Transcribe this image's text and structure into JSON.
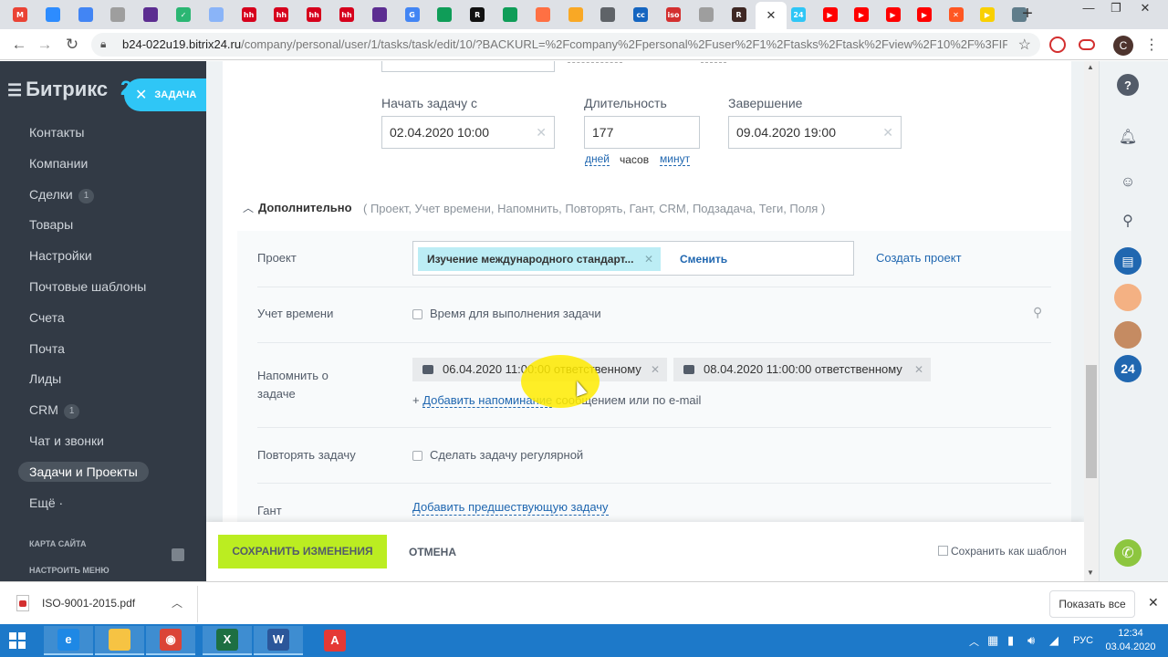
{
  "browser": {
    "tabs": [
      {
        "icon": "gmail-icon",
        "color": "#ea4335",
        "glyph": "M"
      },
      {
        "icon": "video-icon",
        "color": "#2d8cff",
        "glyph": ""
      },
      {
        "icon": "docs-icon",
        "color": "#4285f4",
        "glyph": ""
      },
      {
        "icon": "chart-icon",
        "color": "#9e9e9e",
        "glyph": ""
      },
      {
        "icon": "form-icon",
        "color": "#5c2d91",
        "glyph": ""
      },
      {
        "icon": "check-icon",
        "color": "#2bb673",
        "glyph": "✓"
      },
      {
        "icon": "cube-icon",
        "color": "#8ab4f8",
        "glyph": ""
      },
      {
        "icon": "hh-icon",
        "color": "#d6001c",
        "glyph": "hh"
      },
      {
        "icon": "hh-icon",
        "color": "#d6001c",
        "glyph": "hh"
      },
      {
        "icon": "hh-icon",
        "color": "#d6001c",
        "glyph": "hh"
      },
      {
        "icon": "hh-icon",
        "color": "#d6001c",
        "glyph": "hh"
      },
      {
        "icon": "form-icon",
        "color": "#5c2d91",
        "glyph": ""
      },
      {
        "icon": "google-icon",
        "color": "#4285f4",
        "glyph": "G"
      },
      {
        "icon": "sheets-icon",
        "color": "#0f9d58",
        "glyph": ""
      },
      {
        "icon": "r-icon",
        "color": "#111111",
        "glyph": "R"
      },
      {
        "icon": "home-icon",
        "color": "#0f9d58",
        "glyph": ""
      },
      {
        "icon": "refresh-icon",
        "color": "#ff7043",
        "glyph": ""
      },
      {
        "icon": "search-icon",
        "color": "#f9a825",
        "glyph": ""
      },
      {
        "icon": "globe-icon",
        "color": "#5f6368",
        "glyph": ""
      },
      {
        "icon": "cc-icon",
        "color": "#1565c0",
        "glyph": "cc"
      },
      {
        "icon": "iso-icon",
        "color": "#d32f2f",
        "glyph": "iso"
      },
      {
        "icon": "clock-icon",
        "color": "#9e9e9e",
        "glyph": ""
      },
      {
        "icon": "r-icon",
        "color": "#3e2723",
        "glyph": "R"
      }
    ],
    "tabs_after": [
      {
        "icon": "b24-icon",
        "color": "#2fc6f6",
        "glyph": "24"
      },
      {
        "icon": "youtube-icon",
        "color": "#ff0000",
        "glyph": "▶"
      },
      {
        "icon": "youtube-icon",
        "color": "#ff0000",
        "glyph": "▶"
      },
      {
        "icon": "youtube-icon",
        "color": "#ff0000",
        "glyph": "▶"
      },
      {
        "icon": "youtube-icon",
        "color": "#ff0000",
        "glyph": "▶"
      },
      {
        "icon": "x-icon",
        "color": "#ff5722",
        "glyph": "✕"
      },
      {
        "icon": "play-icon",
        "color": "#f9d000",
        "glyph": "▶"
      },
      {
        "icon": "bird-icon",
        "color": "#607d8b",
        "glyph": ""
      }
    ],
    "url_host": "b24-022u19.bitrix24.ru",
    "url_path": "/company/personal/user/1/tasks/task/edit/10/?BACKURL=%2Fcompany%2Fpersonal%2Fuser%2F1%2Ftasks%2Ftask%2Fview%2F10%2F%3FIFR...",
    "profile_letter": "C"
  },
  "sidebar": {
    "logo": "Битрикс",
    "logo_num": "24",
    "task_button": "ЗАДАЧА",
    "items": [
      {
        "label": "Контакты",
        "count": ""
      },
      {
        "label": "Компании",
        "count": ""
      },
      {
        "label": "Сделки",
        "count": "1"
      },
      {
        "label": "Товары",
        "count": ""
      },
      {
        "label": "Настройки",
        "count": ""
      },
      {
        "label": "Почтовые шаблоны",
        "count": ""
      },
      {
        "label": "Счета",
        "count": ""
      },
      {
        "label": "Почта",
        "count": ""
      },
      {
        "label": "Лиды",
        "count": ""
      },
      {
        "label": "CRM",
        "count": "1"
      },
      {
        "label": "Чат и звонки",
        "count": ""
      },
      {
        "label": "Задачи и Проекты",
        "count": ""
      },
      {
        "label": "Ещё ·",
        "count": ""
      }
    ],
    "sitemap": "КАРТА САЙТА",
    "configure": "НАСТРОИТЬ МЕНЮ"
  },
  "form": {
    "start_label": "Начать задачу с",
    "start_value": "02.04.2020 10:00",
    "duration_label": "Длительность",
    "duration_value": "177",
    "unit_days": "дней",
    "unit_hours": "часов",
    "unit_minutes": "минут",
    "end_label": "Завершение",
    "end_value": "09.04.2020 19:00",
    "additional_title": "Дополнительно",
    "additional_options": "( Проект,  Учет времени,  Напомнить,  Повторять,  Гант,  CRM,  Подзадача,  Теги,  Поля )",
    "project_label": "Проект",
    "project_tag": "Изучение международного стандарт...",
    "project_change": "Сменить",
    "project_create": "Создать проект",
    "time_label": "Учет времени",
    "time_checkbox": "Время для выполнения задачи",
    "remind_label": "Напомнить о задаче",
    "remind_1": "06.04.2020 11:00:00 ответственному",
    "remind_2": "08.04.2020 11:00:00 ответственному",
    "remind_add_prefix": "+ ",
    "remind_add_link": "Добавить напоминание",
    "remind_add_suffix": " сообщением или по e-mail",
    "repeat_label": "Повторять задачу",
    "repeat_checkbox": "Сделать задачу регулярной",
    "gantt_label": "Гант",
    "gantt_link": "Добавить предшествующую задачу"
  },
  "actions": {
    "save": "СОХРАНИТЬ ИЗМЕНЕНИЯ",
    "cancel": "ОТМЕНА",
    "template": "Сохранить как шаблон"
  },
  "right_panel": {
    "b24_badge": "24"
  },
  "download": {
    "file": "ISO-9001-2015.pdf",
    "show_all": "Показать все"
  },
  "taskbar": {
    "lang": "РУС",
    "time": "12:34",
    "date": "03.04.2020",
    "apps": [
      {
        "icon": "ie-icon",
        "color": "#1e88e5",
        "glyph": "e"
      },
      {
        "icon": "explorer-icon",
        "color": "#f6c343",
        "glyph": ""
      },
      {
        "icon": "chrome-icon",
        "color": "#db4437",
        "glyph": "◉"
      },
      {
        "icon": "excel-icon",
        "color": "#1d6f42",
        "glyph": "X"
      },
      {
        "icon": "word-icon",
        "color": "#2b579a",
        "glyph": "W"
      },
      {
        "icon": "pdf-icon",
        "color": "#e53935",
        "glyph": "A"
      }
    ]
  }
}
